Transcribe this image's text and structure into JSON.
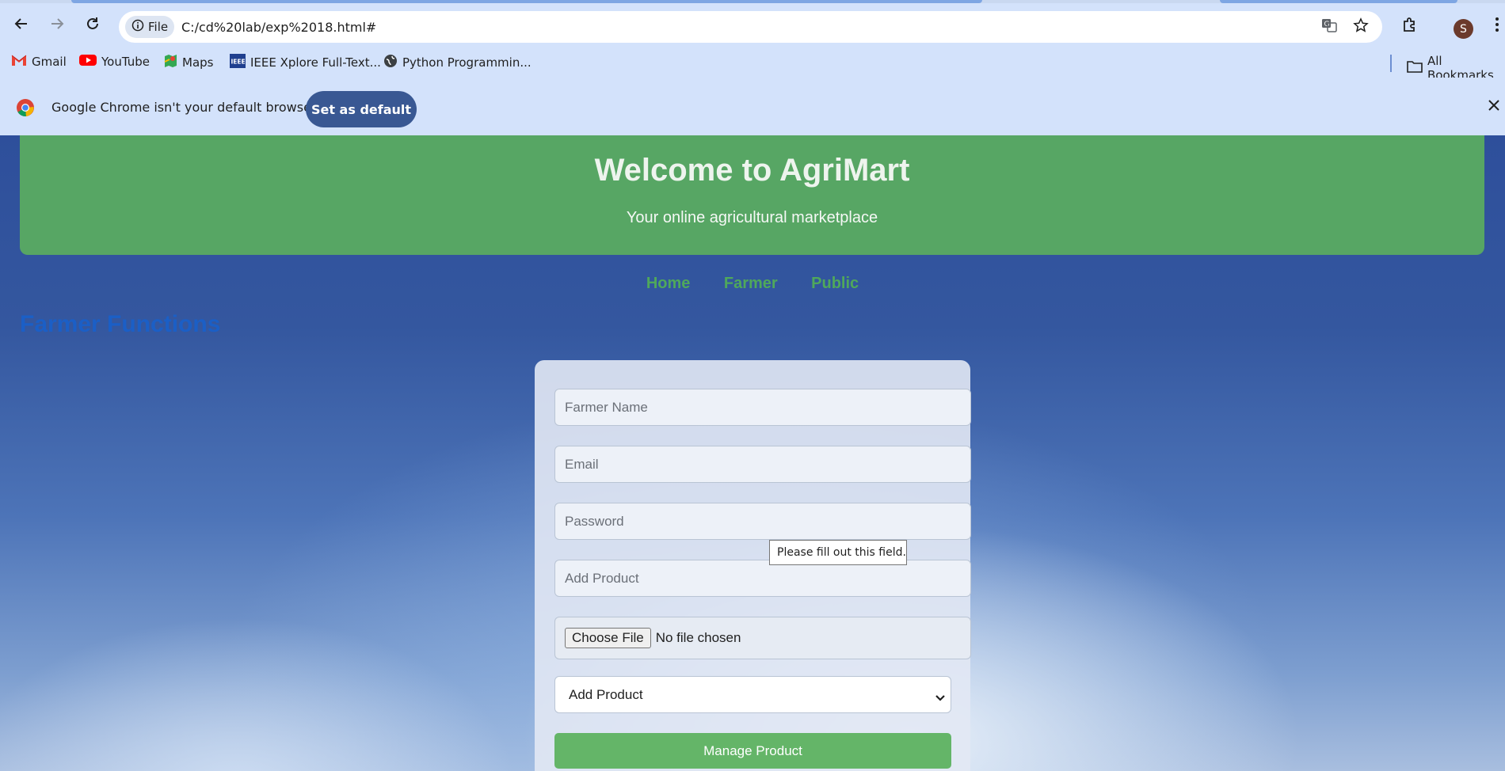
{
  "browser": {
    "address_chip": "File",
    "url": "C:/cd%20lab/exp%2018.html#",
    "profile_initial": "S",
    "bookmarks": [
      {
        "label": "Gmail",
        "icon": "gmail-icon"
      },
      {
        "label": "YouTube",
        "icon": "youtube-icon"
      },
      {
        "label": "Maps",
        "icon": "maps-icon"
      },
      {
        "label": "IEEE Xplore Full-Text...",
        "icon": "ieee-icon"
      },
      {
        "label": "Python Programmin...",
        "icon": "globe-icon"
      }
    ],
    "all_bookmarks": "All Bookmarks",
    "infobar": {
      "message": "Google Chrome isn't your default browser",
      "button": "Set as default"
    }
  },
  "page": {
    "header": {
      "title": "Welcome to AgriMart",
      "subtitle": "Your online agricultural marketplace"
    },
    "nav": [
      "Home",
      "Farmer",
      "Public"
    ],
    "section_title": "Farmer Functions",
    "form": {
      "farmer_name_placeholder": "Farmer Name",
      "email_placeholder": "Email",
      "password_placeholder": "Password",
      "add_product_placeholder": "Add Product",
      "file_button": "Choose File",
      "file_status": "No file chosen",
      "select_value": "Add Product",
      "submit": "Manage Product"
    },
    "validation_tooltip": "Please fill out this field."
  },
  "colors": {
    "header_green": "#57a664",
    "nav_green": "#4fa85b",
    "section_blue": "#1b5fc6",
    "button_green": "#64b568",
    "infobar_button": "#395893"
  }
}
